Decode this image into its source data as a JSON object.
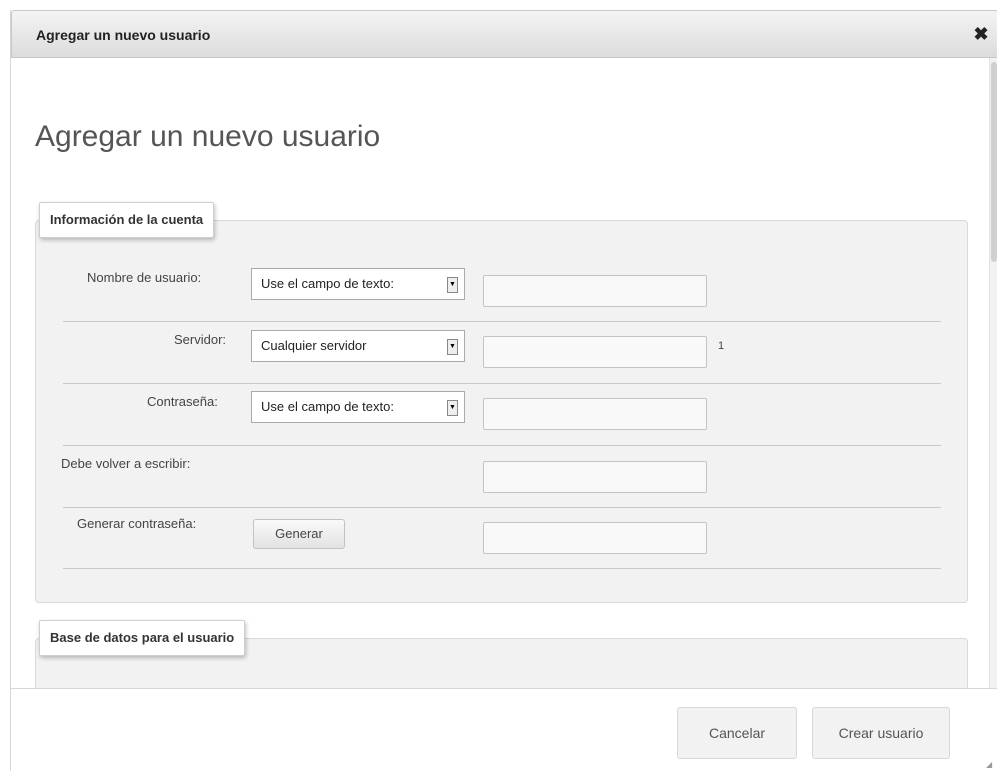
{
  "dialog": {
    "title": "Agregar un nuevo usuario",
    "close_icon": "close-icon",
    "close_glyph": "✖"
  },
  "page": {
    "heading": "Agregar un nuevo usuario"
  },
  "account_section": {
    "legend": "Información de la cuenta",
    "rows": [
      {
        "label": "Nombre de usuario:",
        "select_value": "Use el campo de texto:",
        "input_value": ""
      },
      {
        "label": "Servidor:",
        "select_value": "Cualquier servidor",
        "input_value": "",
        "hint": "1"
      },
      {
        "label": "Contraseña:",
        "select_value": "Use el campo de texto:",
        "input_value": ""
      },
      {
        "label": "Debe volver a escribir:",
        "input_value": ""
      },
      {
        "label": "Generar contraseña:",
        "button_label": "Generar",
        "input_value": ""
      }
    ]
  },
  "database_section": {
    "legend": "Base de datos para el usuario"
  },
  "footer": {
    "cancel_label": "Cancelar",
    "create_label": "Crear usuario"
  },
  "icons": {
    "select_arrow": "▼"
  }
}
